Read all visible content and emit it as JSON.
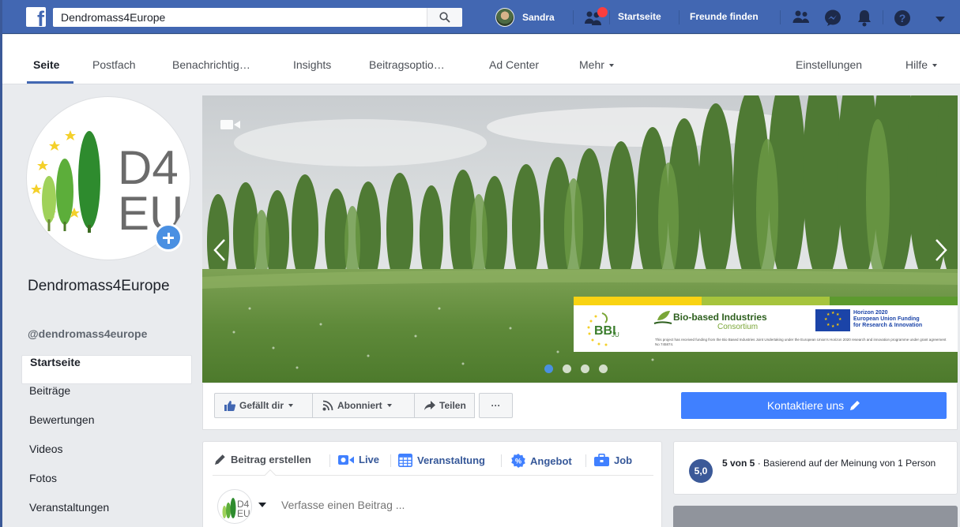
{
  "topbar": {
    "search_value": "Dendromass4Europe",
    "user_name": "Sandra",
    "home_label": "Startseite",
    "find_friends_label": "Freunde finden"
  },
  "pagenav": {
    "items": [
      "Seite",
      "Postfach",
      "Benachrichtig…",
      "Insights",
      "Beitragsoptio…",
      "Ad Center",
      "Mehr"
    ],
    "right_items": [
      "Einstellungen",
      "Hilfe"
    ]
  },
  "profile": {
    "logo_line1": "D4",
    "logo_line2": "EU",
    "page_name": "Dendromass4Europe",
    "handle": "@dendromass4europe"
  },
  "leftnav": {
    "items": [
      "Startseite",
      "Beiträge",
      "Bewertungen",
      "Videos",
      "Fotos",
      "Veranstaltungen"
    ]
  },
  "cover": {
    "banner": {
      "bbi_text": "BBI",
      "bbi_ju": "JU",
      "bic_title": "Bio-based Industries",
      "bic_sub": "Consortium",
      "eu_line1": "Horizon 2020",
      "eu_line2": "European Union Funding",
      "eu_line3": "for Research & Innovation",
      "small_text": "This project has received funding from the Bio Based Industries Joint Undertaking under the European Union's Horizon 2020 research and innovation programme under grant agreement No 745874."
    },
    "slides_total": 4,
    "active_slide": 1
  },
  "actions": {
    "like_label": "Gefällt dir",
    "follow_label": "Abonniert",
    "share_label": "Teilen",
    "more_label": "···",
    "contact_label": "Kontaktiere uns"
  },
  "composer": {
    "tabs": [
      "Beitrag erstellen",
      "Live",
      "Veranstaltung",
      "Angebot",
      "Job"
    ],
    "placeholder": "Verfasse einen Beitrag ..."
  },
  "rating": {
    "score": "5,0",
    "headline": "5 von 5",
    "dot": " · ",
    "detail": "Basierend auf der Meinung von 1 Person"
  },
  "colors": {
    "brand_blue": "#4267b2",
    "contact_blue": "#4080ff",
    "notification_red": "#fa3e3e"
  }
}
